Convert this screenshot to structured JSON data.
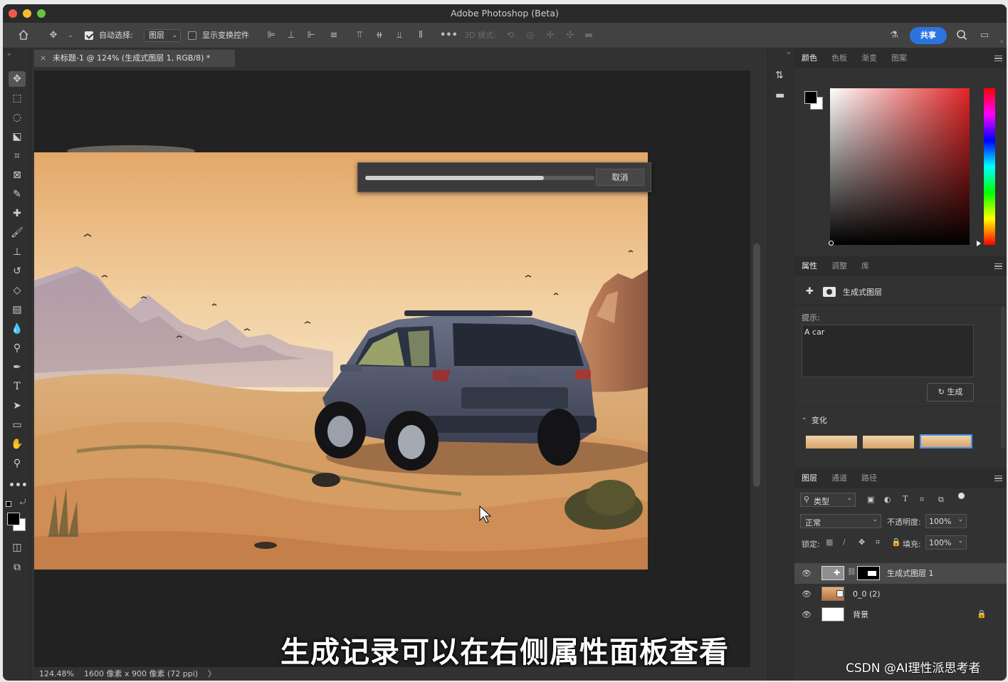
{
  "window": {
    "title": "Adobe Photoshop (Beta)"
  },
  "options_bar": {
    "auto_select_label": "自动选择:",
    "auto_select_target": "图层",
    "show_transform_label": "显示变换控件",
    "mode_3d_label": "3D 模式:",
    "share_label": "共享"
  },
  "document": {
    "tab_title": "未标题-1 @ 124% (生成式图层 1, RGB/8) *",
    "status_zoom": "124.48%",
    "status_info": "1600 像素 x 900 像素 (72 ppi)",
    "status_arrow": "〉"
  },
  "progress_dialog": {
    "progress": 0.78,
    "cancel_label": "取消"
  },
  "caption": "生成记录可以在右侧属性面板查看",
  "color_panel": {
    "tabs": [
      "颜色",
      "色板",
      "渐变",
      "图案"
    ],
    "foreground": "#000000",
    "background": "#ffffff",
    "hue_color": "#e02424"
  },
  "properties_panel": {
    "tabs": [
      "属性",
      "调整",
      "库"
    ],
    "layer_type": "生成式图层",
    "prompt_label": "提示:",
    "prompt_value": "A car",
    "generate_label": "生成",
    "variations_label": "变化"
  },
  "layers_panel": {
    "tabs": [
      "图层",
      "通道",
      "路径"
    ],
    "filter_kind": "类型",
    "blend_mode": "正常",
    "opacity_label": "不透明度:",
    "opacity_value": "100%",
    "lock_label": "锁定:",
    "fill_label": "填充:",
    "fill_value": "100%",
    "layers": [
      {
        "name": "生成式图层 1",
        "selected": true
      },
      {
        "name": "0_0 (2)",
        "selected": false
      },
      {
        "name": "背景",
        "selected": false
      }
    ]
  },
  "watermark": "CSDN @AI理性派思考者"
}
